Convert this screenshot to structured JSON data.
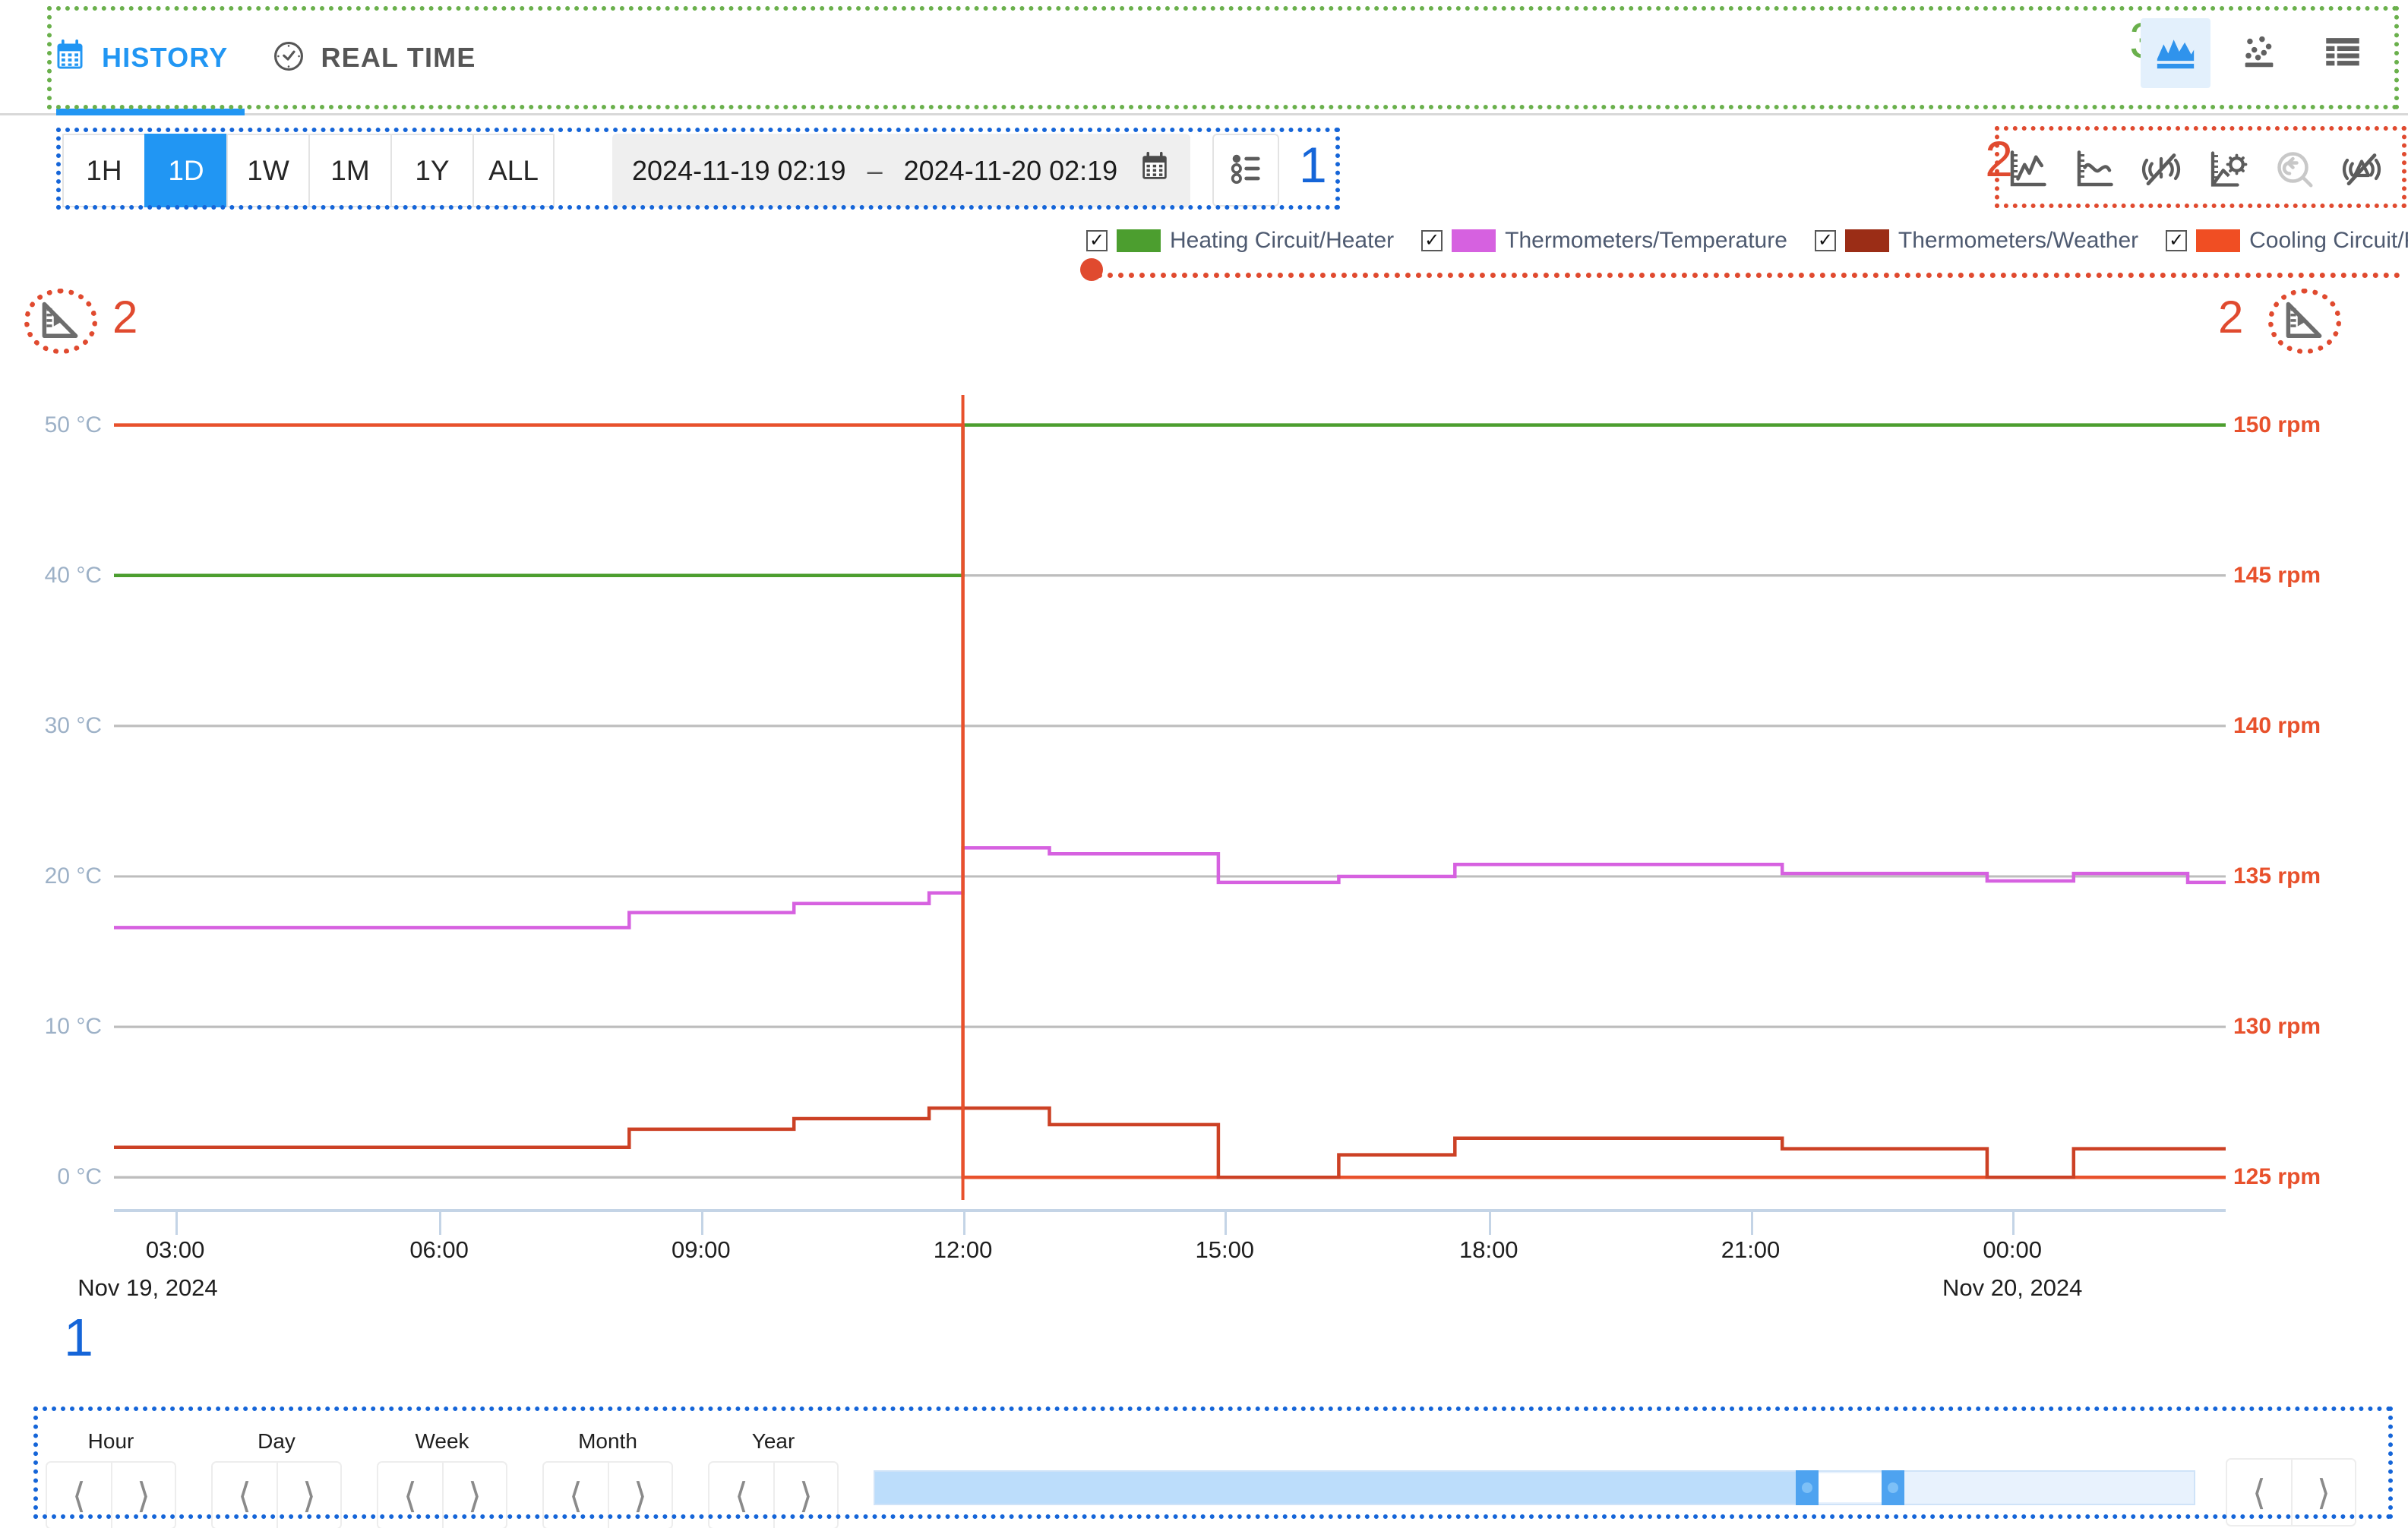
{
  "tabs": [
    {
      "label": "HISTORY",
      "icon": "calendar-icon",
      "active": true
    },
    {
      "label": "REAL TIME",
      "icon": "clock-icon",
      "active": false
    }
  ],
  "view_modes": [
    {
      "name": "area-chart-view",
      "label": "Area chart",
      "active": true
    },
    {
      "name": "scatter-plot-view",
      "label": "Scatter plot",
      "active": false
    },
    {
      "name": "table-view",
      "label": "Table",
      "active": false
    }
  ],
  "toolbar": {
    "ranges": [
      {
        "label": "1H",
        "active": false
      },
      {
        "label": "1D",
        "active": true
      },
      {
        "label": "1W",
        "active": false
      },
      {
        "label": "1M",
        "active": false
      },
      {
        "label": "1Y",
        "active": false
      },
      {
        "label": "ALL",
        "active": false
      }
    ],
    "date_from": "2024-11-19 02:19",
    "date_separator": "–",
    "date_to": "2024-11-20 02:19",
    "calendar_icon": "calendar-icon",
    "list_button_icon": "timeline-list-icon"
  },
  "chart_tools": [
    {
      "name": "raw-data-icon",
      "label": "Raw data",
      "disabled": false
    },
    {
      "name": "smoothed-line-icon",
      "label": "Smoothed line",
      "disabled": false
    },
    {
      "name": "hide-noise-icon",
      "label": "Hide noise",
      "disabled": false
    },
    {
      "name": "chart-settings-icon",
      "label": "Chart settings",
      "disabled": false
    },
    {
      "name": "reset-zoom-icon",
      "label": "Reset zoom",
      "disabled": true
    },
    {
      "name": "hide-alarms-icon",
      "label": "Hide alarms",
      "disabled": false
    }
  ],
  "annotations": [
    {
      "id": "green-3",
      "label": "3",
      "color": "#6ab04c"
    },
    {
      "id": "blue-1-toolbar",
      "label": "1",
      "color": "#1565d8"
    },
    {
      "id": "red-2-tools",
      "label": "2",
      "color": "#e04a2f"
    },
    {
      "id": "red-2-left-axis",
      "label": "2",
      "color": "#e04a2f"
    },
    {
      "id": "red-2-right-axis",
      "label": "2",
      "color": "#e04a2f"
    },
    {
      "id": "blue-1-bottomnav",
      "label": "1",
      "color": "#1565d8"
    }
  ],
  "axis_icons": {
    "left": "axis-scale-icon",
    "right": "axis-scale-icon"
  },
  "bottom_nav": {
    "steppers": [
      {
        "label": "Hour",
        "prev_icon": "chevron-left-icon",
        "next_icon": "chevron-right-icon"
      },
      {
        "label": "Day",
        "prev_icon": "chevron-left-icon",
        "next_icon": "chevron-right-icon"
      },
      {
        "label": "Week",
        "prev_icon": "chevron-left-icon",
        "next_icon": "chevron-right-icon"
      },
      {
        "label": "Month",
        "prev_icon": "chevron-left-icon",
        "next_icon": "chevron-right-icon"
      },
      {
        "label": "Year",
        "prev_icon": "chevron-left-icon",
        "next_icon": "chevron-right-icon"
      }
    ],
    "scroll_prev_icon": "chevron-left-icon",
    "scroll_next_icon": "chevron-right-icon",
    "slider": {
      "fill_pct": 70.5,
      "window_start_pct": 70.5,
      "window_end_pct": 77.0
    }
  },
  "chart_data": {
    "type": "line",
    "title": "",
    "xlabel": "",
    "ylabel": "",
    "grid": true,
    "legend_position": "top",
    "x_start": "2024-11-19 02:19",
    "x_end": "2024-11-20 02:19",
    "x_ticks": [
      {
        "label": "03:00",
        "pos_pct": 2.9
      },
      {
        "label": "06:00",
        "pos_pct": 15.4
      },
      {
        "label": "09:00",
        "pos_pct": 27.8
      },
      {
        "label": "12:00",
        "pos_pct": 40.2
      },
      {
        "label": "15:00",
        "pos_pct": 52.6
      },
      {
        "label": "18:00",
        "pos_pct": 65.1
      },
      {
        "label": "21:00",
        "pos_pct": 77.5
      },
      {
        "label": "00:00",
        "pos_pct": 89.9
      }
    ],
    "x_date_labels": [
      {
        "label": "Nov 19, 2024",
        "pos_pct": 1.6
      },
      {
        "label": "Nov 20, 2024",
        "pos_pct": 89.9
      }
    ],
    "left_axis": {
      "unit": "°C",
      "ticks": [
        "0 °C",
        "10 °C",
        "20 °C",
        "30 °C",
        "40 °C",
        "50 °C"
      ],
      "values": [
        0,
        10,
        20,
        30,
        40,
        50
      ],
      "range": [
        -1.5,
        52
      ],
      "color": "#9db1c7"
    },
    "right_axis": {
      "unit": "rpm",
      "ticks": [
        "125 rpm",
        "130 rpm",
        "135 rpm",
        "140 rpm",
        "145 rpm",
        "150 rpm"
      ],
      "values": [
        125,
        130,
        135,
        140,
        145,
        150
      ],
      "range": [
        124.25,
        151
      ],
      "color": "#e8512c"
    },
    "series": [
      {
        "name": "Heating Circuit/Heater",
        "color": "#4c9e2f",
        "axis": "right",
        "unit": "rpm",
        "style": "step",
        "points": [
          {
            "t_pct": 0.0,
            "v": 145
          },
          {
            "t_pct": 40.2,
            "v": 145
          },
          {
            "t_pct": 40.2,
            "v": 150
          },
          {
            "t_pct": 100.0,
            "v": 150
          }
        ]
      },
      {
        "name": "Thermometers/Temperature",
        "color": "#d661e0",
        "axis": "left",
        "unit": "°C",
        "style": "step",
        "points": [
          {
            "t_pct": 0.0,
            "v": 16.6
          },
          {
            "t_pct": 24.4,
            "v": 16.6
          },
          {
            "t_pct": 24.4,
            "v": 17.6
          },
          {
            "t_pct": 32.2,
            "v": 17.6
          },
          {
            "t_pct": 32.2,
            "v": 18.2
          },
          {
            "t_pct": 38.6,
            "v": 18.2
          },
          {
            "t_pct": 38.6,
            "v": 18.9
          },
          {
            "t_pct": 40.2,
            "v": 18.9
          },
          {
            "t_pct": 40.2,
            "v": 21.9
          },
          {
            "t_pct": 44.3,
            "v": 21.9
          },
          {
            "t_pct": 44.3,
            "v": 21.5
          },
          {
            "t_pct": 52.3,
            "v": 21.5
          },
          {
            "t_pct": 52.3,
            "v": 19.6
          },
          {
            "t_pct": 58.0,
            "v": 19.6
          },
          {
            "t_pct": 58.0,
            "v": 20.0
          },
          {
            "t_pct": 63.5,
            "v": 20.0
          },
          {
            "t_pct": 63.5,
            "v": 20.8
          },
          {
            "t_pct": 79.0,
            "v": 20.8
          },
          {
            "t_pct": 79.0,
            "v": 20.2
          },
          {
            "t_pct": 88.7,
            "v": 20.2
          },
          {
            "t_pct": 88.7,
            "v": 19.7
          },
          {
            "t_pct": 92.8,
            "v": 19.7
          },
          {
            "t_pct": 92.8,
            "v": 20.2
          },
          {
            "t_pct": 98.2,
            "v": 20.2
          },
          {
            "t_pct": 98.2,
            "v": 19.6
          },
          {
            "t_pct": 100.0,
            "v": 19.6
          }
        ]
      },
      {
        "name": "Thermometers/Weather",
        "color": "#9b2d16",
        "axis": "left",
        "unit": "°C",
        "style": "step",
        "points": []
      },
      {
        "name": "Cooling Circuit/Fan",
        "color": "#e8512c",
        "axis": "right",
        "unit": "rpm",
        "style": "step",
        "points": [
          {
            "t_pct": 0.0,
            "v": 150
          },
          {
            "t_pct": 40.2,
            "v": 150
          },
          {
            "t_pct": 40.2,
            "v": 125
          },
          {
            "t_pct": 100.0,
            "v": 125
          }
        ]
      },
      {
        "name": "Cooling Circuit/Fan (secondary)",
        "color": "#cc4125",
        "axis": "left",
        "unit": "°C",
        "style": "step",
        "points": [
          {
            "t_pct": 0.0,
            "v": 2.0
          },
          {
            "t_pct": 24.4,
            "v": 2.0
          },
          {
            "t_pct": 24.4,
            "v": 3.2
          },
          {
            "t_pct": 32.2,
            "v": 3.2
          },
          {
            "t_pct": 32.2,
            "v": 3.9
          },
          {
            "t_pct": 38.6,
            "v": 3.9
          },
          {
            "t_pct": 38.6,
            "v": 4.6
          },
          {
            "t_pct": 44.3,
            "v": 4.6
          },
          {
            "t_pct": 44.3,
            "v": 3.5
          },
          {
            "t_pct": 52.3,
            "v": 3.5
          },
          {
            "t_pct": 52.3,
            "v": 0.0
          },
          {
            "t_pct": 58.0,
            "v": 0.0
          },
          {
            "t_pct": 58.0,
            "v": 1.5
          },
          {
            "t_pct": 63.5,
            "v": 1.5
          },
          {
            "t_pct": 63.5,
            "v": 2.6
          },
          {
            "t_pct": 79.0,
            "v": 2.6
          },
          {
            "t_pct": 79.0,
            "v": 1.9
          },
          {
            "t_pct": 88.7,
            "v": 1.9
          },
          {
            "t_pct": 88.7,
            "v": 0.0
          },
          {
            "t_pct": 92.8,
            "v": 0.0
          },
          {
            "t_pct": 92.8,
            "v": 1.9
          },
          {
            "t_pct": 100.0,
            "v": 1.9
          }
        ]
      }
    ],
    "marker_line": {
      "t_pct": 40.2,
      "color": "#e8512c"
    }
  }
}
